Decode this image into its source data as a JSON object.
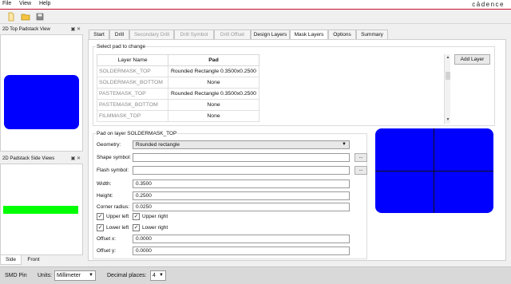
{
  "menu": {
    "file": "File",
    "view": "View",
    "help": "Help",
    "logo": "cādence"
  },
  "colors": {
    "pad_fill": "#0000ff",
    "side_bar": "#00ff00",
    "accent_red": "#c8102e"
  },
  "toolbar": {
    "icons": [
      "new-file-icon",
      "open-folder-icon",
      "save-disk-icon"
    ]
  },
  "top_view": {
    "title": "2D Top Padstack View"
  },
  "side_view": {
    "title": "2D Padstack Side Views",
    "tabs": [
      "Side",
      "Front"
    ]
  },
  "tabs": [
    "Start",
    "Drill",
    "Secondary Drill",
    "Drill Symbol",
    "Drill Offset",
    "Design Layers",
    "Mask Layers",
    "Options",
    "Summary"
  ],
  "active_tab": "Mask Layers",
  "select_group": {
    "title": "Select pad to change",
    "col_layer": "Layer Name",
    "col_pad": "Pad",
    "rows": [
      {
        "layer": "SOLDERMASK_TOP",
        "pad": "Rounded Rectangle 0.3500x0.2500"
      },
      {
        "layer": "SOLDERMASK_BOTTOM",
        "pad": "None"
      },
      {
        "layer": "PASTEMASK_TOP",
        "pad": "Rounded Rectangle 0.3500x0.2500"
      },
      {
        "layer": "PASTEMASK_BOTTOM",
        "pad": "None"
      },
      {
        "layer": "FILMMASK_TOP",
        "pad": "None"
      }
    ],
    "add_layer": "Add Layer"
  },
  "pad_group": {
    "title": "Pad on layer SOLDERMASK_TOP",
    "geometry_label": "Geometry:",
    "geometry_value": "Rounded rectangle",
    "shape_label": "Shape symbol:",
    "shape_value": "",
    "flash_label": "Flash symbol:",
    "flash_value": "",
    "browse": "...",
    "width_label": "Width:",
    "width_value": "0.3500",
    "height_label": "Height:",
    "height_value": "0.2500",
    "corner_label": "Corner radius:",
    "corner_value": "0.0250",
    "upper_left": "Upper left",
    "upper_right": "Upper right",
    "lower_left": "Lower left",
    "lower_right": "Lower right",
    "offx_label": "Offset x:",
    "offx_value": "0.0000",
    "offy_label": "Offset y:",
    "offy_value": "0.0000"
  },
  "status": {
    "mode": "SMD Pin",
    "units_label": "Units:",
    "units_value": "Millimeter",
    "decimal_label": "Decimal places:",
    "decimal_value": "4"
  }
}
